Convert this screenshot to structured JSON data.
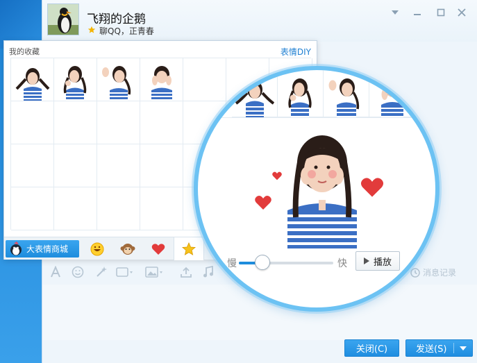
{
  "window": {
    "contact_name": "飞翔的企鹅",
    "contact_status": "聊QQ，正青春"
  },
  "emoji_panel": {
    "title": "我的收藏",
    "diy_label": "表情DIY",
    "store_label": "大表情商城"
  },
  "preview": {
    "slow_label": "慢",
    "fast_label": "快",
    "play_label": "播放",
    "speed_fraction": 0.25
  },
  "toolbar": {
    "history_label": "消息记录"
  },
  "buttons": {
    "close_label": "关闭(C)",
    "send_label": "发送(S)"
  },
  "colors": {
    "accent": "#1e8ddd",
    "magnifier_ring": "#6cc2f3",
    "heart": "#e23b3b"
  }
}
